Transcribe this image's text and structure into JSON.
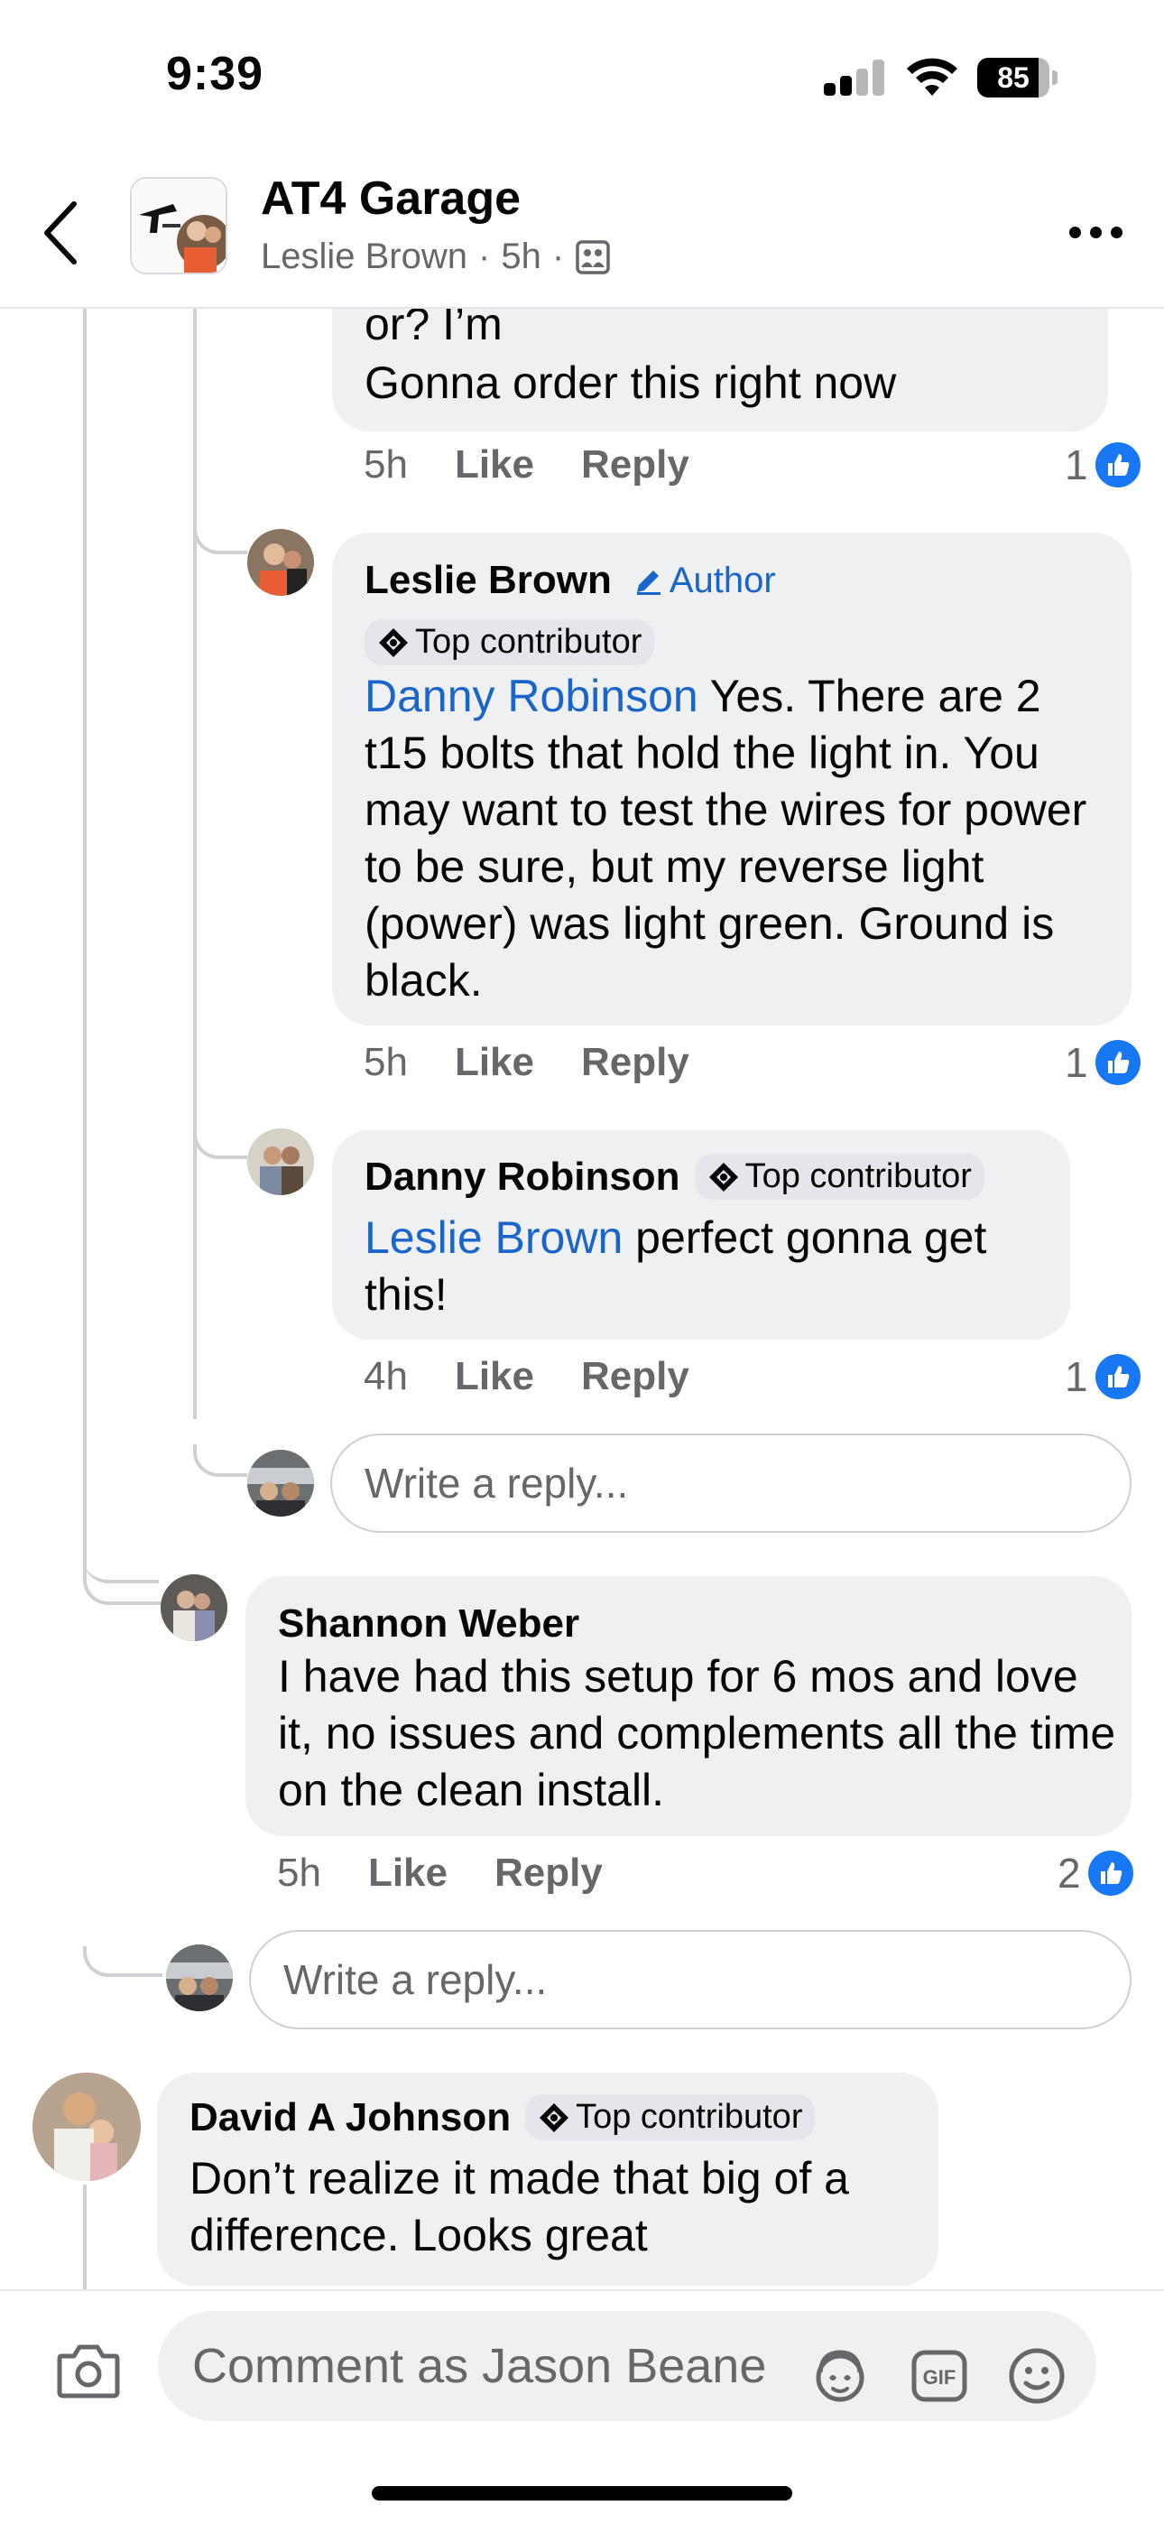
{
  "status_bar": {
    "time": "9:39",
    "battery_level": "85",
    "battery_fraction": 0.85
  },
  "header": {
    "title": "AT4 Garage",
    "author": "Leslie Brown",
    "age": "5h",
    "separator": "·",
    "back_icon": "chevron-left-icon",
    "more_icon": "more-icon",
    "visibility_icon": "group-members-icon"
  },
  "comments": {
    "top_partial": {
      "text_line1": "or? I’m",
      "text_line2": "Gonna order this right now",
      "time": "5h",
      "like": "Like",
      "reply": "Reply",
      "reaction_count": "1"
    },
    "leslie": {
      "name": "Leslie Brown",
      "author_label": "Author",
      "badge": "Top contributor",
      "mention": "Danny Robinson",
      "text": " Yes. There are 2 t15 bolts that hold the light in. You may want to test the wires for power to be sure, but my reverse light (power) was light green. Ground is black.",
      "time": "5h",
      "like": "Like",
      "reply": "Reply",
      "reaction_count": "1"
    },
    "danny": {
      "name": "Danny Robinson",
      "badge": "Top contributor",
      "mention": "Leslie Brown",
      "text": " perfect gonna get this!",
      "time": "4h",
      "like": "Like",
      "reply": "Reply",
      "reaction_count": "1"
    },
    "reply_placeholder_nested": "Write a reply...",
    "shannon": {
      "name": "Shannon Weber",
      "text": "I have had this setup for 6 mos and love it, no issues and complements all the time on the clean install.",
      "time": "5h",
      "like": "Like",
      "reply": "Reply",
      "reaction_count": "2"
    },
    "reply_placeholder_top": "Write a reply...",
    "david": {
      "name": "David A Johnson",
      "badge": "Top contributor",
      "text": "Don’t realize it made that big of a difference. Looks great"
    }
  },
  "composer": {
    "placeholder": "Comment as Jason Beane",
    "icons": [
      "camera-icon",
      "avatar-sticker-icon",
      "gif-icon",
      "emoji-icon"
    ]
  },
  "colors": {
    "accent": "#1877f2",
    "mention": "#1a65c9",
    "bubble": "#eff0f2",
    "muted": "#65676b"
  }
}
